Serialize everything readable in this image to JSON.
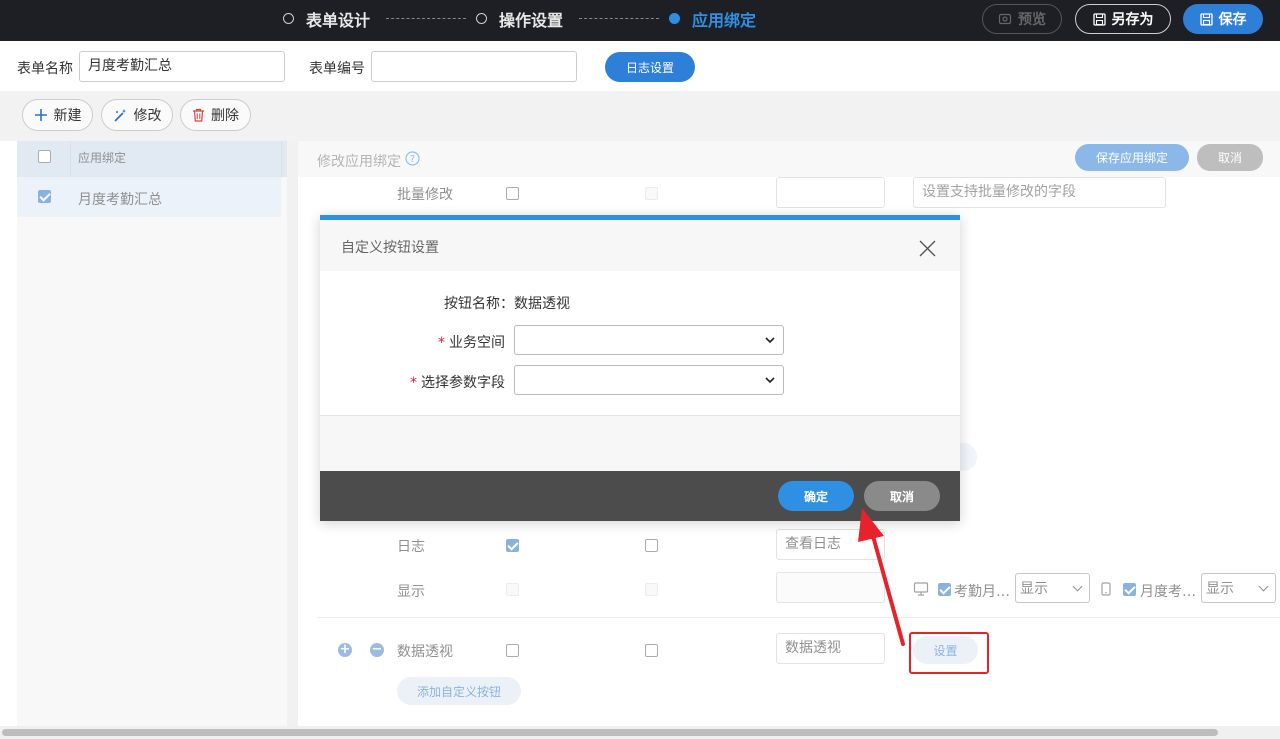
{
  "steps": [
    {
      "label": "表单设计",
      "active": false
    },
    {
      "label": "操作设置",
      "active": false
    },
    {
      "label": "应用绑定",
      "active": true
    }
  ],
  "top_actions": {
    "preview": "预览",
    "save_as": "另存为",
    "save": "保存"
  },
  "form": {
    "name_label": "表单名称",
    "name_value": "月度考勤汇总",
    "code_label": "表单编号",
    "code_value": "",
    "log_settings": "日志设置"
  },
  "toolbar": {
    "new": "新建",
    "edit": "修改",
    "delete": "删除"
  },
  "left_table": {
    "header": "应用绑定",
    "rows": [
      {
        "label": "月度考勤汇总",
        "checked": true
      }
    ]
  },
  "right_panel": {
    "title": "修改应用绑定",
    "save_binding": "保存应用绑定",
    "cancel": "取消",
    "batch_edit": {
      "label": "批量修改",
      "placeholder": "设置支持批量修改的字段"
    },
    "log": {
      "label": "日志",
      "text": "查看日志"
    },
    "display": {
      "label": "显示",
      "pc_label": "考勤月…",
      "pc_value": "显示",
      "mobile_label": "月度考…",
      "mobile_value": "显示"
    },
    "custom_row": {
      "label": "数据透视",
      "text": "数据透视",
      "settings": "设置"
    },
    "add_custom": "添加自定义按钮"
  },
  "modal": {
    "title": "自定义按钮设置",
    "button_name_label": "按钮名称：",
    "button_name_value": "数据透视",
    "workspace_label": "业务空间",
    "param_field_label": "选择参数字段",
    "required_mark": "*",
    "confirm": "确定",
    "cancel": "取消"
  },
  "colors": {
    "accent": "#2e8fe3",
    "primary": "#2d7fd7",
    "annotation": "#e8222a"
  }
}
